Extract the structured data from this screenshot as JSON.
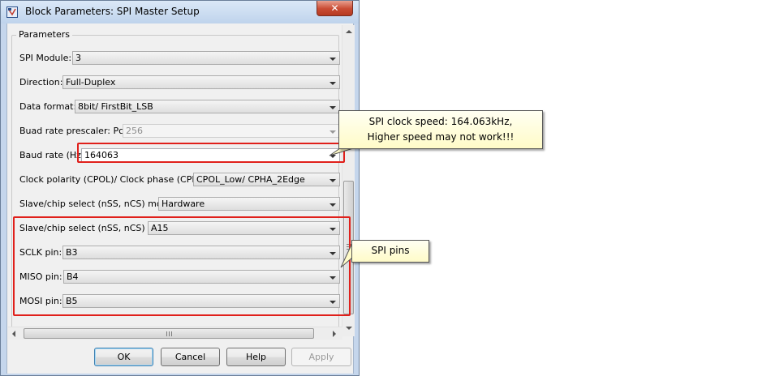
{
  "window": {
    "title": "Block Parameters: SPI Master Setup",
    "close_label": "✕"
  },
  "parameters": {
    "group_label": "Parameters",
    "fields": [
      {
        "label": "SPI Module:",
        "value": "3"
      },
      {
        "label": "Direction:",
        "value": "Full-Duplex"
      },
      {
        "label": "Data format:",
        "value": "8bit/ FirstBit_LSB"
      },
      {
        "label": "Buad rate prescaler: Pclk/",
        "value": "256"
      },
      {
        "label": "Baud rate (Hz)",
        "value": "164063"
      },
      {
        "label": "Clock polarity (CPOL)/ Clock phase (CPHA):",
        "value": "CPOL_Low/ CPHA_2Edge"
      },
      {
        "label": "Slave/chip select (nSS, nCS) mode",
        "value": "Hardware"
      },
      {
        "label": "Slave/chip select (nSS, nCS) pin",
        "value": "A15"
      },
      {
        "label": "SCLK pin:",
        "value": "B3"
      },
      {
        "label": "MISO pin:",
        "value": "B4"
      },
      {
        "label": "MOSI pin:",
        "value": "B5"
      }
    ]
  },
  "buttons": {
    "ok": "OK",
    "cancel": "Cancel",
    "help": "Help",
    "apply": "Apply"
  },
  "callouts": {
    "baud_line1": "SPI clock speed: 164.063kHz,",
    "baud_line2": "Higher speed may not work!!!",
    "pins": "SPI pins"
  },
  "colors": {
    "highlight": "#e0201b",
    "callout_fill": "#fffbc8",
    "title_bar": "#c5d6ec"
  },
  "icons": {
    "app": "simulink-block-icon",
    "close": "close-icon"
  }
}
